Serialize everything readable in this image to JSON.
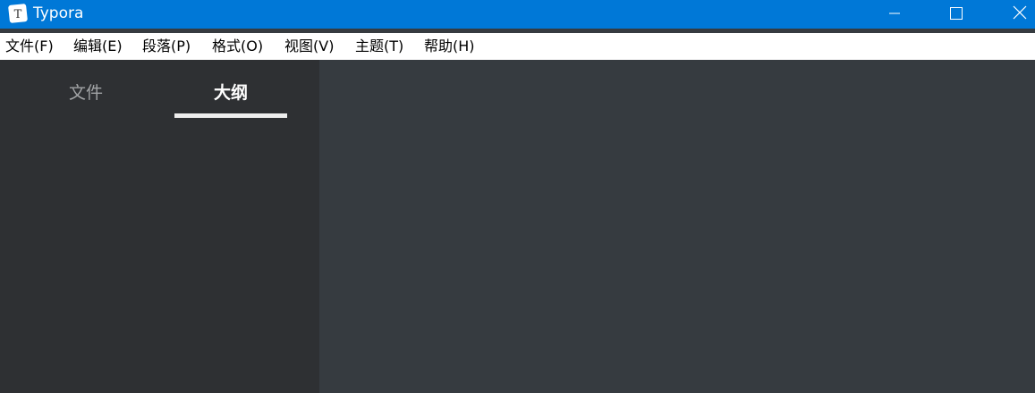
{
  "titlebar": {
    "title": "Typora",
    "icon": "typora-logo-icon",
    "icon_letter": "T",
    "color": "#0078d7",
    "buttons": [
      "minimize-icon",
      "maximize-icon",
      "close-icon"
    ]
  },
  "menu": {
    "items": [
      {
        "label": "文件(F)"
      },
      {
        "label": "编辑(E)"
      },
      {
        "label": "段落(P)"
      },
      {
        "label": "格式(O)"
      },
      {
        "label": "视图(V)"
      },
      {
        "label": "主题(T)"
      },
      {
        "label": "帮助(H)"
      }
    ]
  },
  "sidebar": {
    "tabs": [
      {
        "label": "文件",
        "active": false
      },
      {
        "label": "大纲",
        "active": true
      }
    ],
    "background": "#2e3033"
  },
  "editor": {
    "background": "#363b40"
  }
}
